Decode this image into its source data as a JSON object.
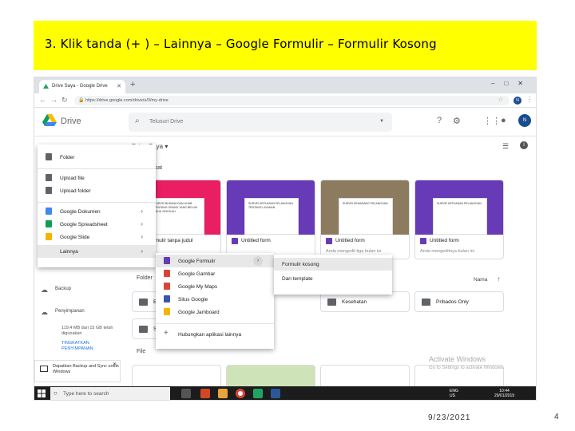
{
  "slide": {
    "title": "3. Klik  tanda  (+ ) – Lainnya – Google Formulir – Formulir Kosong",
    "date": "9/23/2021",
    "page_number": "4"
  },
  "browser": {
    "tab_title": "Drive Saya - Google Drive",
    "url": "https://drive.google.com/drive/u/0/my-drive",
    "avatar": "N"
  },
  "drive": {
    "logo_text": "Drive",
    "search_placeholder": "Telusuri Drive",
    "my_drive": "Drive Saya",
    "quick_access": "Akses cepat",
    "avatar": "N",
    "cards": [
      {
        "name": "Formulir tanpa judul",
        "sub": "",
        "thumb_color": "#e91e63",
        "doc_text": "SURVEI BUSANA DAN HIJAB TENTANG ORANG YANG BELUM TAHU SEKOLAH"
      },
      {
        "name": "Untitled form",
        "sub": "",
        "thumb_color": "#673ab7",
        "doc_text": "SURVEI KEPUASAN PELANGGAN TENTANG LAYANAN"
      },
      {
        "name": "Untitled form",
        "sub": "Anda mengedit tiga bulan ini",
        "thumb_color": "#8d7b60",
        "doc_text": "SURVEI KEMASANG PELANGGAN"
      },
      {
        "name": "Untitled form",
        "sub": "Anda mengeditnya bulan ini",
        "thumb_color": "#673ab7",
        "doc_text": "SURVEI KEPUASAN PELANGGAN"
      }
    ],
    "folder_label": "Folder",
    "sort_label": "Nama",
    "folders": [
      "B",
      "S",
      "Kesehatan",
      "Pribados Only"
    ],
    "file_label": "File",
    "activate_title": "Activate Windows",
    "activate_sub": "Go to Settings to activate Windows."
  },
  "sidebar": {
    "backup": "Backup",
    "storage_title": "Penyimpanan",
    "storage_used": "119,4 MB dari 15 GB telah digunakan",
    "upgrade": "TINGKATKAN PENYIMPANAN",
    "backup_promo": "Dapatkan Backup and Sync untuk Windows"
  },
  "new_menu": [
    {
      "label": "Folder",
      "icon": "folder-icon",
      "color": "#5f6368",
      "chevron": ""
    },
    {
      "label": "Upload file",
      "icon": "file-upload-icon",
      "color": "#5f6368",
      "chevron": ""
    },
    {
      "label": "Upload folder",
      "icon": "folder-upload-icon",
      "color": "#5f6368",
      "chevron": ""
    },
    {
      "label": "Google Dokumen",
      "icon": "docs-icon",
      "color": "#4285f4",
      "chevron": "›"
    },
    {
      "label": "Google Spreadsheet",
      "icon": "sheets-icon",
      "color": "#0f9d58",
      "chevron": "›"
    },
    {
      "label": "Google Slide",
      "icon": "slides-icon",
      "color": "#f4b400",
      "chevron": "›"
    },
    {
      "label": "Lainnya",
      "icon": "",
      "color": "",
      "chevron": "›"
    }
  ],
  "more_menu": [
    {
      "label": "Google Formulir",
      "icon": "forms-icon",
      "color": "#673ab7"
    },
    {
      "label": "Google Gambar",
      "icon": "drawings-icon",
      "color": "#db4437"
    },
    {
      "label": "Google My Maps",
      "icon": "mymaps-icon",
      "color": "#db4437"
    },
    {
      "label": "Situs Google",
      "icon": "sites-icon",
      "color": "#3f51b5"
    },
    {
      "label": "Google Jamboard",
      "icon": "jamboard-icon",
      "color": "#f4b400"
    },
    {
      "label": "Hubungkan aplikasi lainnya",
      "icon": "plus-icon",
      "color": "#5f6368"
    }
  ],
  "forms_submenu": [
    "Formulir kosong",
    "Dari template"
  ],
  "taskbar": {
    "search": "Type here to search",
    "lang": "ENG",
    "region": "US",
    "time": "10:44",
    "date": "29/01/2019"
  }
}
